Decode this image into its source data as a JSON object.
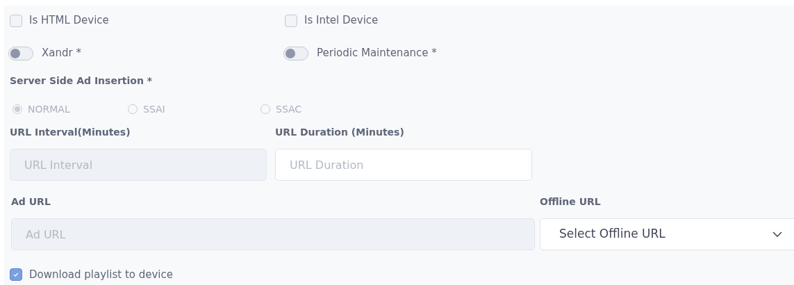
{
  "device_flags": [
    {
      "label": "Is HTML Device",
      "checked": false
    },
    {
      "label": "Is Intel Device",
      "checked": false
    }
  ],
  "toggles": [
    {
      "label": "Xandr *",
      "on": false
    },
    {
      "label": "Periodic Maintenance *",
      "on": false
    }
  ],
  "ad_insertion": {
    "label": "Server Side Ad Insertion *",
    "disabled": true,
    "options": [
      {
        "label": "NORMAL",
        "selected": true
      },
      {
        "label": "SSAI",
        "selected": false
      },
      {
        "label": "SSAC",
        "selected": false
      }
    ]
  },
  "interval_fields": [
    {
      "label": "URL Interval(Minutes)",
      "placeholder": "URL Interval",
      "disabled": true
    },
    {
      "label": "URL Duration (Minutes)",
      "placeholder": "URL Duration",
      "disabled": false
    }
  ],
  "ad_url": {
    "label": "Ad URL",
    "placeholder": "Ad URL",
    "disabled": true
  },
  "offline_url": {
    "label": "Offline URL",
    "value": "Select Offline URL"
  },
  "download_playlist": {
    "label": "Download playlist to device",
    "checked": true
  }
}
